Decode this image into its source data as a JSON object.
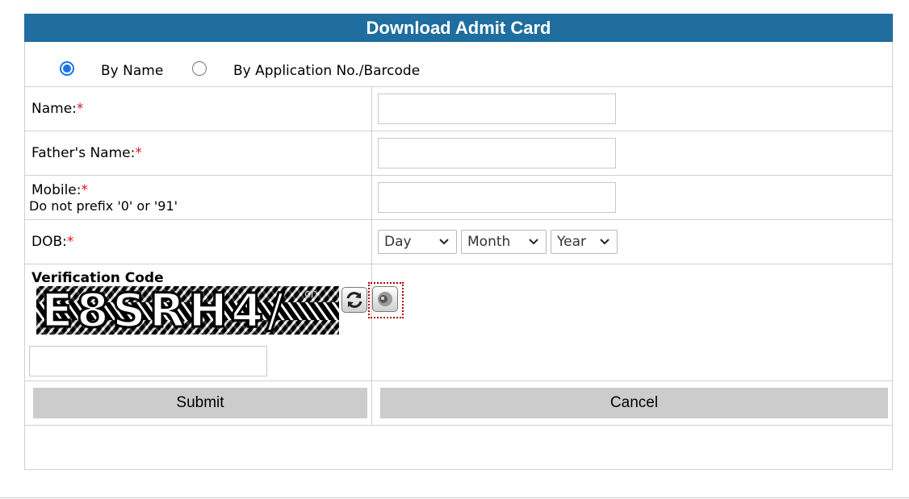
{
  "header": {
    "title": "Download Admit Card"
  },
  "search_mode": {
    "options": [
      {
        "label": "By Name",
        "selected": true
      },
      {
        "label": "By Application No./Barcode",
        "selected": false
      }
    ]
  },
  "fields": {
    "name": {
      "label": "Name:",
      "required_mark": "*",
      "value": ""
    },
    "father_name": {
      "label": "Father's Name:",
      "required_mark": "*",
      "value": ""
    },
    "mobile": {
      "label": "Mobile:",
      "required_mark": "*",
      "hint": "Do not prefix '0' or '91'",
      "value": ""
    },
    "dob": {
      "label": "DOB:",
      "required_mark": "*",
      "day": "Day",
      "month": "Month",
      "year": "Year"
    }
  },
  "verification": {
    "title": "Verification Code",
    "captcha_text": "E8SRH4/",
    "captcha_tag": "cn",
    "refresh_icon": "refresh-icon",
    "audio_icon": "speaker-icon",
    "value": ""
  },
  "actions": {
    "submit_label": "Submit",
    "cancel_label": "Cancel"
  },
  "colors": {
    "header_bg": "#1f6e9f",
    "required": "#e0101a",
    "radio_accent": "#1a73e8",
    "button_bg": "#cccccc"
  }
}
